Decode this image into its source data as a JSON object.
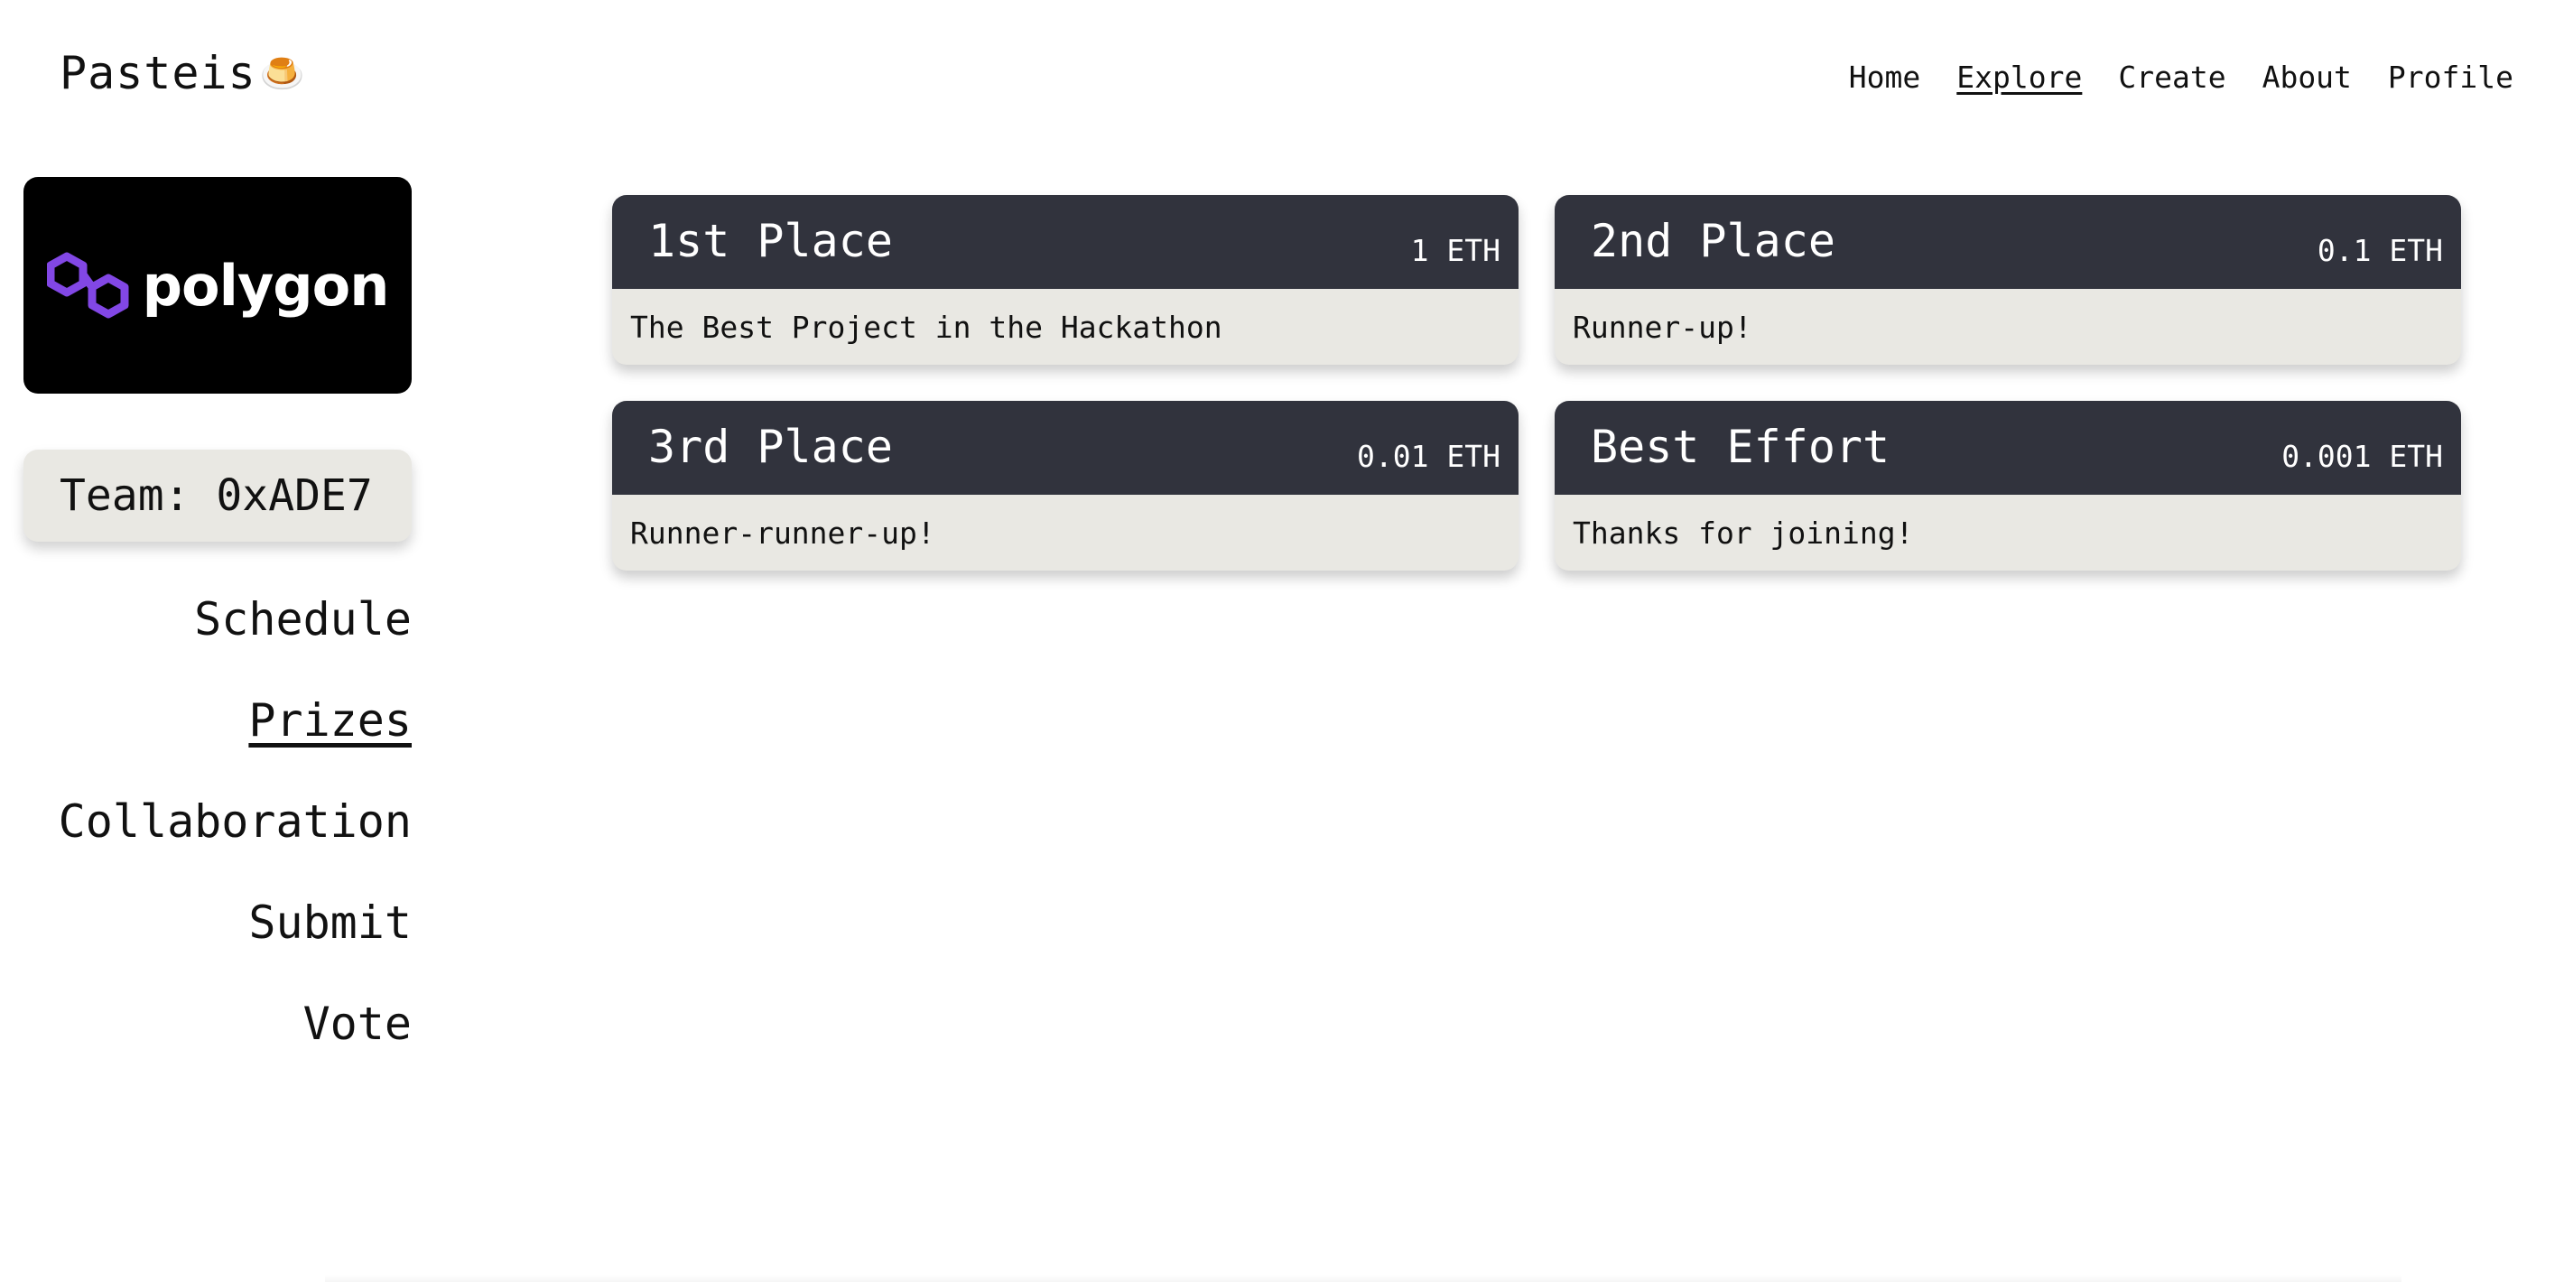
{
  "brand": {
    "name": "Pasteis",
    "emoji": "🍮"
  },
  "topnav": {
    "items": [
      {
        "label": "Home"
      },
      {
        "label": "Explore"
      },
      {
        "label": "Create"
      },
      {
        "label": "About"
      },
      {
        "label": "Profile"
      }
    ],
    "active": "Explore"
  },
  "sidebar": {
    "logo_text": "polygon",
    "logo_color": "#8247e5",
    "team_label": "Team: 0xADE7",
    "items": [
      {
        "label": "Schedule"
      },
      {
        "label": "Prizes"
      },
      {
        "label": "Collaboration"
      },
      {
        "label": "Submit"
      },
      {
        "label": "Vote"
      }
    ],
    "active": "Prizes"
  },
  "prizes": [
    {
      "title": "1st Place",
      "amount": "1 ETH",
      "description": "The Best Project in the Hackathon"
    },
    {
      "title": "2nd Place",
      "amount": "0.1 ETH",
      "description": "Runner-up!"
    },
    {
      "title": "3rd Place",
      "amount": "0.01 ETH",
      "description": "Runner-runner-up!"
    },
    {
      "title": "Best Effort",
      "amount": "0.001 ETH",
      "description": "Thanks for joining!"
    }
  ],
  "colors": {
    "card_header": "#31333d",
    "card_body": "#e9e8e3",
    "accent_purple": "#8247e5"
  }
}
